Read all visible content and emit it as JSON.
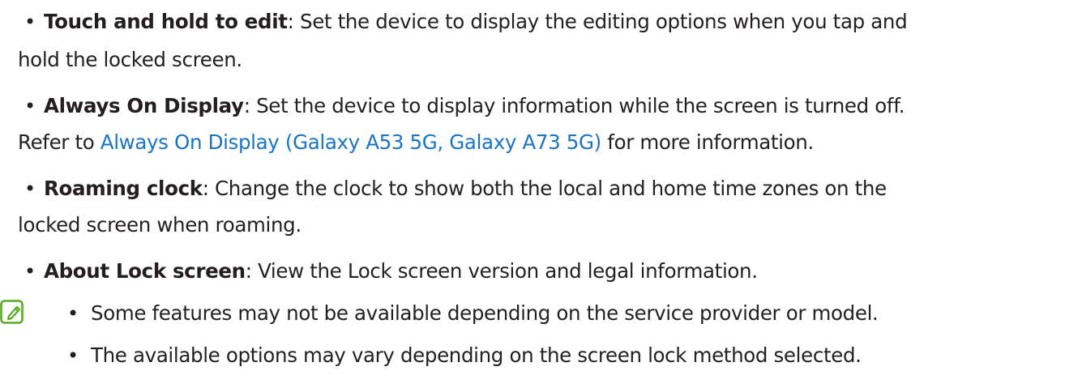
{
  "bullets": {
    "symbol": "•"
  },
  "items": [
    {
      "term": "Touch and hold to edit",
      "separator": ":",
      "line1": " Set the device to display the editing options when you tap and",
      "line2": "hold the locked screen."
    },
    {
      "term": "Always On Display",
      "separator": ":",
      "line1": " Set the device to display information while the screen is turned off.",
      "line2_prefix": "Refer to ",
      "link": "Always On Display (Galaxy A53 5G, Galaxy A73 5G)",
      "line2_suffix": " for more information."
    },
    {
      "term": "Roaming clock",
      "separator": ":",
      "line1": " Change the clock to show both the local and home time zones on the",
      "line2": "locked screen when roaming."
    },
    {
      "term": "About Lock screen",
      "separator": ":",
      "line1": " View the Lock screen version and legal information."
    }
  ],
  "note": {
    "icon": "note-pencil-icon",
    "items": [
      "Some features may not be available depending on the service provider or model.",
      "The available options may vary depending on the screen lock method selected."
    ]
  },
  "colors": {
    "text": "#231f20",
    "link": "#1a75c7",
    "note_icon": "#5aaa28"
  }
}
